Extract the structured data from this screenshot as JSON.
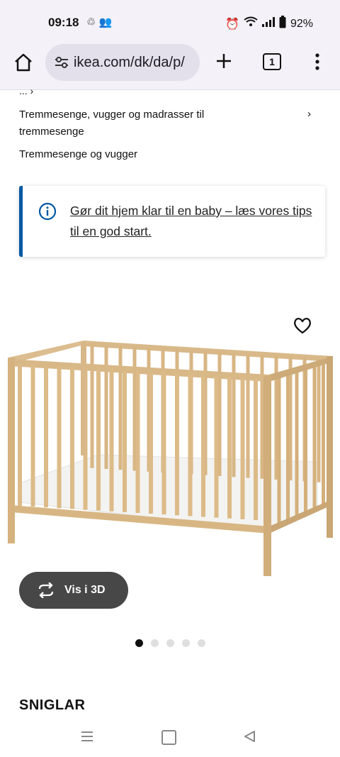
{
  "status_bar": {
    "time": "09:18",
    "left_icons": [
      "recycle-icon",
      "people-icon"
    ],
    "battery": "92%",
    "right_icons": [
      "alarm-icon",
      "wifi-icon",
      "signal-icon",
      "battery-icon"
    ]
  },
  "browser": {
    "url": "ikea.com/dk/da/p/",
    "tab_count": "1"
  },
  "breadcrumb": {
    "ellipsis": "... ›",
    "level1": "Tremmesenge, vugger og madrasser til tremmesenge",
    "level1_chevron": "›",
    "level2": "Tremmesenge og vugger"
  },
  "info_banner": {
    "text": "Gør dit hjem klar til en baby – læs vores tips til en god start.",
    "accent_color": "#0058a3"
  },
  "product": {
    "view3d_label": "Vis i 3D",
    "name": "SNIGLAR",
    "carousel": {
      "count": 5,
      "active": 1
    }
  }
}
